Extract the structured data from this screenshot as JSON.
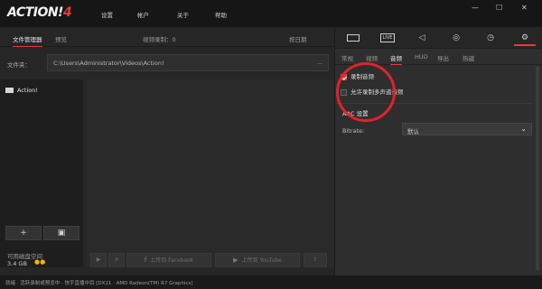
{
  "app": {
    "logo_main": "ACTION!",
    "logo_version": "4",
    "menu": [
      "设置",
      "帐户",
      "关于",
      "帮助"
    ],
    "window_buttons": [
      "—",
      "☐",
      "✕"
    ]
  },
  "left": {
    "tabs": {
      "file_manager": "文件管理器",
      "preview": "预览",
      "video_recording": "视频录制：0",
      "sort": "按日期"
    },
    "folder_label": "文件夹：",
    "folder_path": "C:\\Users\\Administrator\\Videos\\Action!",
    "folder_more": "...",
    "files": [
      {
        "name": "Action!"
      }
    ],
    "add_button": "+",
    "disk": {
      "title": "可用磁盘空间",
      "size": "3.4 GB",
      "dots": "●●"
    },
    "actions": {
      "play": "▶",
      "delete": "✕",
      "facebook": "上传到 Facebook",
      "youtube": "上传到 YouTube",
      "more": "⇪"
    }
  },
  "right": {
    "icon_tabs": [
      "video-tab",
      "live-tab",
      "audio-tab",
      "screenshot-tab",
      "timer-tab",
      "settings-tab"
    ],
    "live_label": "LIVE",
    "sub_tabs": [
      "常规",
      "视频",
      "音频",
      "HUD",
      "导出",
      "热键"
    ],
    "active_sub_tab": "音频",
    "record_audio": {
      "label": "录制音频",
      "checked": true
    },
    "multi_audio": {
      "label": "允许录制多声道音频",
      "checked": false
    },
    "aac_section": "AAC 设置",
    "bitrate_label": "Bitrate:",
    "bitrate_value": "默认"
  },
  "status": {
    "text": "就绪 · 活跃录制或预览中 · 快手直播中目 [DX11 · AMD Radeon(TM) R7 Graphics]"
  },
  "colors": {
    "accent": "#e53935",
    "annotation": "#e0222b",
    "disk_dot": "#f5b400"
  }
}
